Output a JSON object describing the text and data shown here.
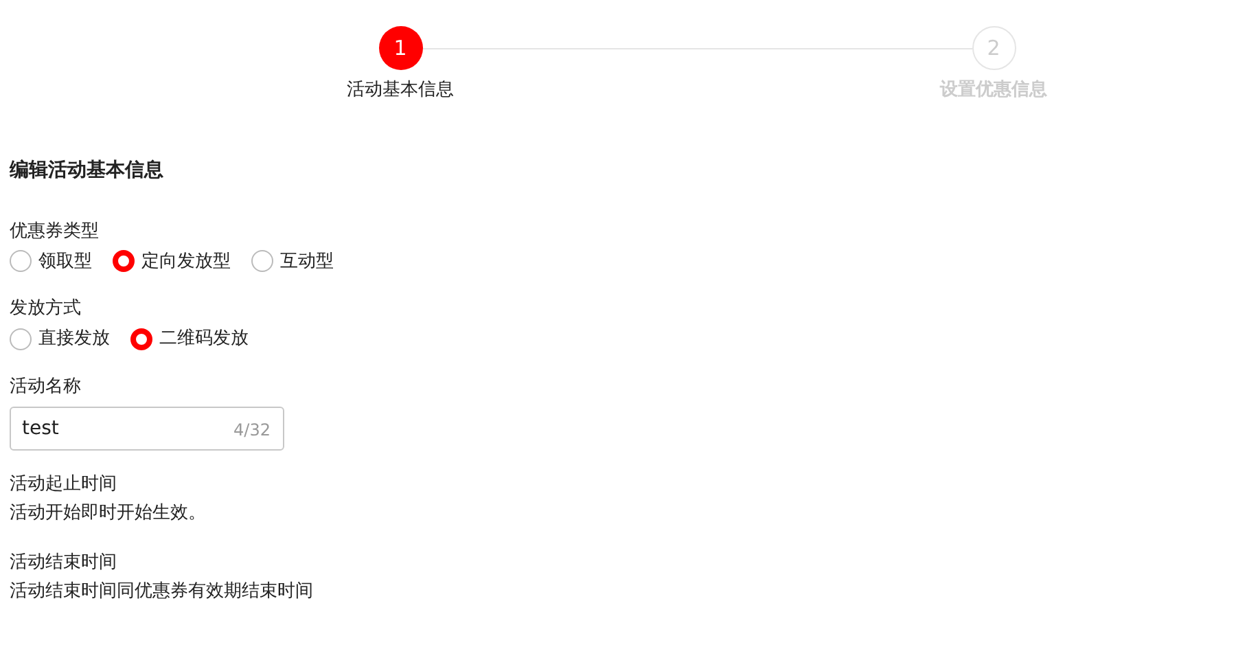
{
  "steps": [
    {
      "number": "1",
      "label": "活动基本信息",
      "selected": true
    },
    {
      "number": "2",
      "label": "设置优惠信息",
      "selected": false
    }
  ],
  "section_title": "编辑活动基本信息",
  "fields": [
    {
      "kind": "radio",
      "label": "优惠券类型",
      "options": [
        {
          "label": "领取型",
          "selected": false
        },
        {
          "label": "定向发放型",
          "selected": true
        },
        {
          "label": "互动型",
          "selected": false
        }
      ]
    },
    {
      "kind": "radio",
      "label": "发放方式",
      "options": [
        {
          "label": "直接发放",
          "selected": false
        },
        {
          "label": "二维码发放",
          "selected": true
        }
      ]
    },
    {
      "kind": "input",
      "label": "活动名称",
      "value": "test",
      "counter": "4/32"
    },
    {
      "kind": "text",
      "label": "活动起止时间",
      "text": "活动开始即时开始生效。"
    },
    {
      "kind": "text",
      "label": "活动结束时间",
      "text": "活动结束时间同优惠券有效期结束时间"
    }
  ]
}
